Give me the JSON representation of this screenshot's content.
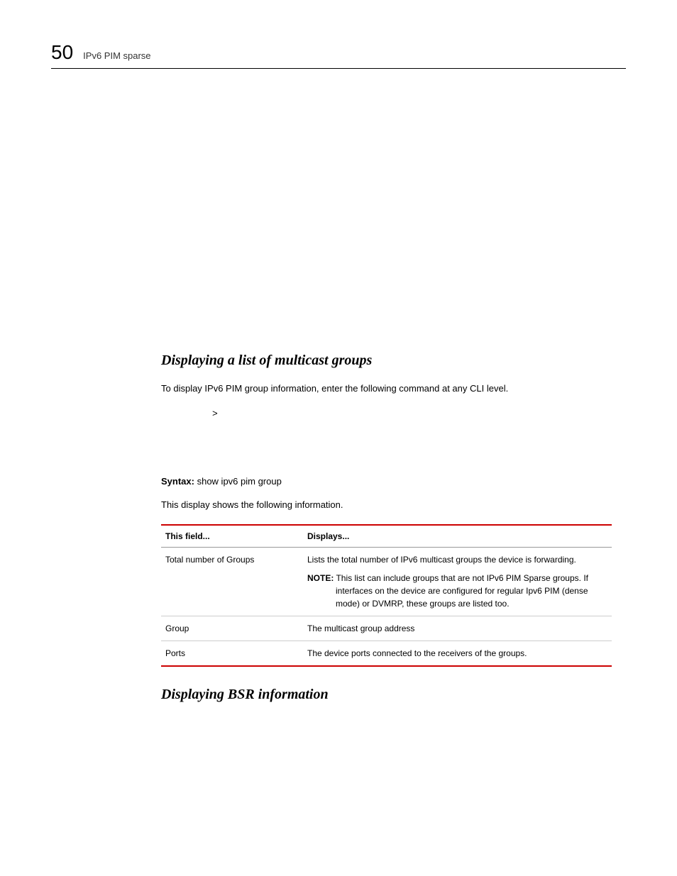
{
  "header": {
    "page_number": "50",
    "title": "IPv6 PIM sparse"
  },
  "section1": {
    "heading": "Displaying a list of multicast groups",
    "intro": "To display IPv6 PIM  group information, enter the following command at any CLI level.",
    "cli_prompt": ">",
    "syntax_label": "Syntax:",
    "syntax_command": "show ipv6 pim group",
    "info_line": "This display shows the following information."
  },
  "table": {
    "header_field": "This field...",
    "header_displays": "Displays...",
    "rows": [
      {
        "field": "Total number of Groups",
        "displays": "Lists the total number of IPv6 multicast groups the device is forwarding.",
        "note_label": "NOTE:",
        "note_text": "This list can include groups that are not IPv6 PIM Sparse groups.  If interfaces on the device are configured for regular Ipv6 PIM (dense mode) or DVMRP, these groups are listed too."
      },
      {
        "field": "Group",
        "displays": "The multicast group address"
      },
      {
        "field": "Ports",
        "displays": "The device ports connected to the receivers of the groups."
      }
    ]
  },
  "section2": {
    "heading": "Displaying BSR information"
  }
}
